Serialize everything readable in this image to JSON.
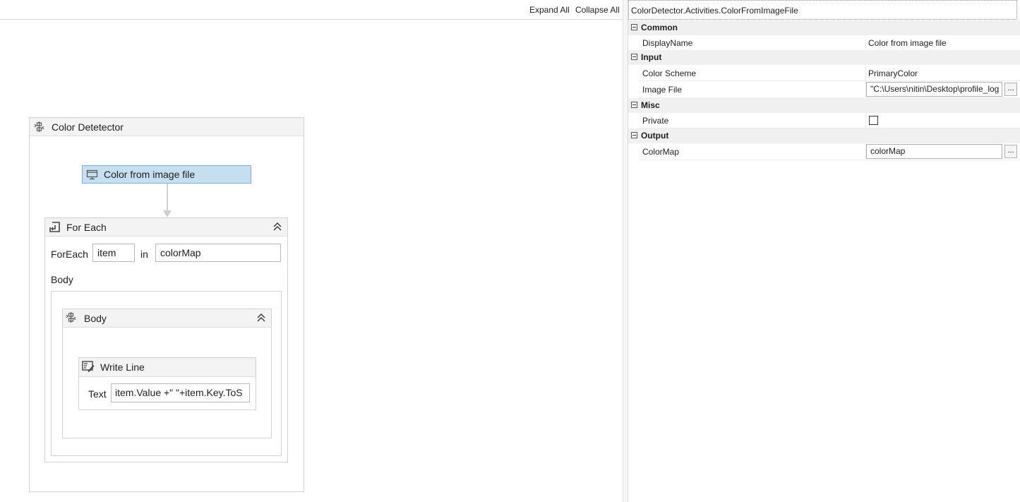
{
  "toolbar": {
    "expand_all": "Expand All",
    "collapse_all": "Collapse All"
  },
  "sequence": {
    "title": "Color Detetector",
    "icon": "sequence-icon"
  },
  "color_activity": {
    "title": "Color from image file",
    "icon": "activity-icon",
    "background": "#c5dff1",
    "border": "#7fb0d8"
  },
  "foreach": {
    "title": "For Each",
    "icon": "foreach-icon",
    "foreach_label": "ForEach",
    "item_value": "item",
    "in_label": "in",
    "collection_value": "colorMap",
    "body_label": "Body"
  },
  "body_seq": {
    "title": "Body",
    "icon": "sequence-icon"
  },
  "writeline": {
    "title": "Write Line",
    "icon": "writeline-icon",
    "text_label": "Text",
    "text_value": "item.Value +\" \"+item.Key.ToS"
  },
  "properties": {
    "title": "ColorDetector.Activities.ColorFromImageFile",
    "categories": {
      "common": "Common",
      "input": "Input",
      "misc": "Misc",
      "output": "Output"
    },
    "rows": {
      "display_name": {
        "name": "DisplayName",
        "value": "Color from image file"
      },
      "color_scheme": {
        "name": "Color Scheme",
        "value": "PrimaryColor"
      },
      "image_file": {
        "name": "Image File",
        "value": "\"C:\\Users\\nitin\\Desktop\\profile_log"
      },
      "private": {
        "name": "Private",
        "checked": false
      },
      "color_map": {
        "name": "ColorMap",
        "value": "colorMap"
      }
    },
    "ellipsis": "..."
  }
}
